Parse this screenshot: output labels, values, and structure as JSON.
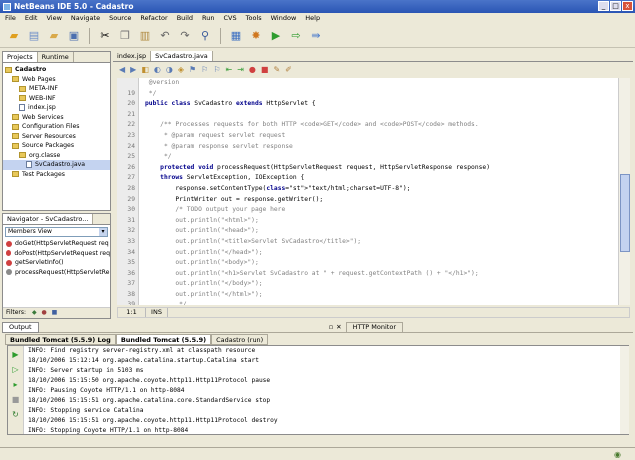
{
  "window": {
    "title": "NetBeans IDE 5.0 - Cadastro",
    "min": "_",
    "max": "□",
    "close": "x"
  },
  "menu": [
    "File",
    "Edit",
    "View",
    "Navigate",
    "Source",
    "Refactor",
    "Build",
    "Run",
    "CVS",
    "Tools",
    "Window",
    "Help"
  ],
  "projects": {
    "tabs": [
      "Projects",
      "Runtime"
    ],
    "rows": [
      {
        "label": "Cadastro",
        "indent": 0,
        "icon": "project"
      },
      {
        "label": "Web Pages",
        "indent": 1,
        "icon": "folder"
      },
      {
        "label": "META-INF",
        "indent": 2,
        "icon": "folder"
      },
      {
        "label": "WEB-INF",
        "indent": 2,
        "icon": "folder"
      },
      {
        "label": "index.jsp",
        "indent": 2,
        "icon": "file"
      },
      {
        "label": "Web Services",
        "indent": 1,
        "icon": "folder"
      },
      {
        "label": "Configuration Files",
        "indent": 1,
        "icon": "folder"
      },
      {
        "label": "Server Resources",
        "indent": 1,
        "icon": "folder"
      },
      {
        "label": "Source Packages",
        "indent": 1,
        "icon": "folder"
      },
      {
        "label": "org.classe",
        "indent": 2,
        "icon": "folder"
      },
      {
        "label": "SvCadastro.java",
        "indent": 3,
        "icon": "file"
      },
      {
        "label": "Test Packages",
        "indent": 1,
        "icon": "folder"
      }
    ]
  },
  "navigator": {
    "title": "Navigator - SvCadastro...",
    "view": "Members View",
    "items": [
      "doGet(HttpServletRequest req",
      "doPost(HttpServletRequest req",
      "getServletInfo()",
      "processRequest(HttpServletRe"
    ],
    "filters_label": "Filters:"
  },
  "editor": {
    "tabs": [
      "index.jsp",
      "SvCadastro.java"
    ],
    "position": "1:1",
    "mode": "INS",
    "lines": [
      {
        "n": "",
        "t": " @version"
      },
      {
        "n": "19",
        "t": " */"
      },
      {
        "n": "20",
        "t": "public class SvCadastro extends HttpServlet {"
      },
      {
        "n": "21",
        "t": ""
      },
      {
        "n": "22",
        "t": "    /** Processes requests for both HTTP <code>GET</code> and <code>POST</code> methods."
      },
      {
        "n": "23",
        "t": "     * @param request servlet request"
      },
      {
        "n": "24",
        "t": "     * @param response servlet response"
      },
      {
        "n": "25",
        "t": "     */"
      },
      {
        "n": "26",
        "t": "    protected void processRequest(HttpServletRequest request, HttpServletResponse response)"
      },
      {
        "n": "27",
        "t": "    throws ServletException, IOException {"
      },
      {
        "n": "28",
        "t": "        response.setContentType(\"text/html;charset=UTF-8\");"
      },
      {
        "n": "29",
        "t": "        PrintWriter out = response.getWriter();"
      },
      {
        "n": "30",
        "t": "        /* TODO output your page here"
      },
      {
        "n": "31",
        "t": "        out.println(\"<html>\");"
      },
      {
        "n": "32",
        "t": "        out.println(\"<head>\");"
      },
      {
        "n": "33",
        "t": "        out.println(\"<title>Servlet SvCadastro</title>\");"
      },
      {
        "n": "34",
        "t": "        out.println(\"</head>\");"
      },
      {
        "n": "35",
        "t": "        out.println(\"<body>\");"
      },
      {
        "n": "36",
        "t": "        out.println(\"<h1>Servlet SvCadastro at \" + request.getContextPath () + \"</h1>\");"
      },
      {
        "n": "37",
        "t": "        out.println(\"</body>\");"
      },
      {
        "n": "38",
        "t": "        out.println(\"</html>\");"
      },
      {
        "n": "39",
        "t": "         */"
      }
    ]
  },
  "output": {
    "title": "Output",
    "other_tab": "HTTP Monitor",
    "tabs": [
      "Bundled Tomcat (5.5.9) Log",
      "Bundled Tomcat (5.5.9)",
      "Cadastro (run)"
    ],
    "lines": [
      "INFO: Find registry server-registry.xml at classpath resource",
      "18/10/2006 15:12:14 org.apache.catalina.startup.Catalina start",
      "INFO: Server startup in 5103 ms",
      "18/10/2006 15:15:50 org.apache.coyote.http11.Http11Protocol pause",
      "INFO: Pausing Coyote HTTP/1.1 on http-8084",
      "18/10/2006 15:15:51 org.apache.catalina.core.StandardService stop",
      "INFO: Stopping service Catalina",
      "18/10/2006 15:15:51 org.apache.coyote.http11.Http11Protocol destroy",
      "INFO: Stopping Coyote HTTP/1.1 on http-8084"
    ]
  }
}
